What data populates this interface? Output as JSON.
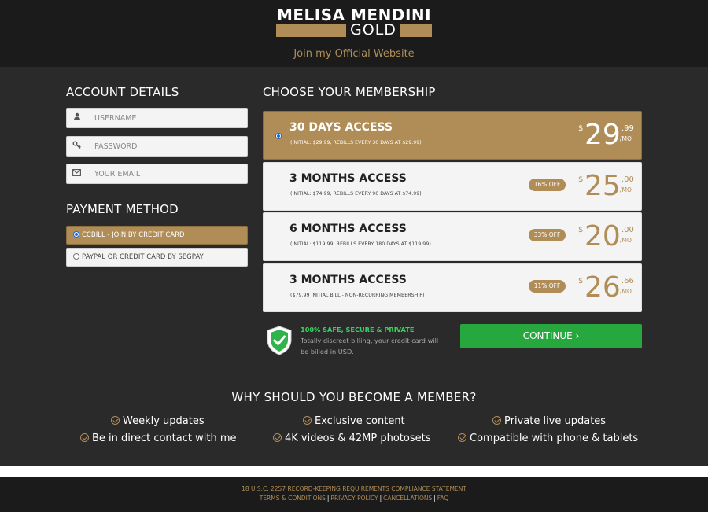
{
  "header": {
    "logo_name": "MELISA MENDINI",
    "logo_suffix": "GOLD",
    "tagline": "Join my Official Website"
  },
  "account": {
    "title": "ACCOUNT DETAILS",
    "username_placeholder": "USERNAME",
    "password_placeholder": "PASSWORD",
    "email_placeholder": "YOUR EMAIL"
  },
  "payment": {
    "title": "PAYMENT METHOD",
    "options": [
      {
        "label": "CCBILL - JOIN BY CREDIT CARD",
        "selected": true
      },
      {
        "label": "PAYPAL OR CREDIT CARD BY SEGPAY",
        "selected": false
      }
    ]
  },
  "membership": {
    "title": "CHOOSE YOUR MEMBERSHIP",
    "plans": [
      {
        "title": "30 DAYS ACCESS",
        "sub": "(INITIAL: $29.99, REBILLS EVERY 30 DAYS AT $29.99)",
        "badge": "",
        "currency": "$",
        "price": "29",
        "cents": ".99",
        "per": "/MO",
        "selected": true
      },
      {
        "title": "3 MONTHS ACCESS",
        "sub": "(INITIAL: $74.99, REBILLS EVERY 90 DAYS AT $74.99)",
        "badge": "16% OFF",
        "currency": "$",
        "price": "25",
        "cents": ".00",
        "per": "/MO",
        "selected": false
      },
      {
        "title": "6 MONTHS ACCESS",
        "sub": "(INITIAL: $119.99, REBILLS EVERY 180 DAYS AT $119.99)",
        "badge": "33% OFF",
        "currency": "$",
        "price": "20",
        "cents": ".00",
        "per": "/MO",
        "selected": false
      },
      {
        "title": "3 MONTHS ACCESS",
        "sub": "($79.99 INITIAL BILL - NON-RECURRING MEMBERSHIP)",
        "badge": "11% OFF",
        "currency": "$",
        "price": "26",
        "cents": ".66",
        "per": "/MO",
        "selected": false
      }
    ]
  },
  "security": {
    "title": "100% SAFE, SECURE & PRIVATE",
    "line1": "Totally discreet billing, your credit card will",
    "line2": "be billed in USD."
  },
  "continue_label": "CONTINUE ›",
  "why": {
    "title": "WHY SHOULD YOU BECOME A MEMBER?",
    "benefits": [
      "Weekly updates",
      "Exclusive content",
      "Private live updates",
      "Be in direct contact with me",
      "4K videos & 42MP photosets",
      "Compatible with phone & tablets"
    ]
  },
  "footer": {
    "statement": "18 U.S.C. 2257 RECORD-KEEPING REQUIREMENTS COMPLIANCE STATEMENT",
    "links": [
      "TERMS & CONDITIONS",
      "PRIVACY POLICY",
      "CANCELLATIONS",
      "FAQ"
    ],
    "separator": "|"
  },
  "colors": {
    "accent_gold": "#b08d57",
    "background_dark": "#2a2a2a",
    "header_dark": "#1b1b1b",
    "continue_green": "#27a83f",
    "secure_green": "#3cd060"
  },
  "icons": {
    "username": "user-icon",
    "password": "key-icon",
    "email": "envelope-icon",
    "secure": "shield-check-icon",
    "benefit": "check-circle-icon"
  }
}
